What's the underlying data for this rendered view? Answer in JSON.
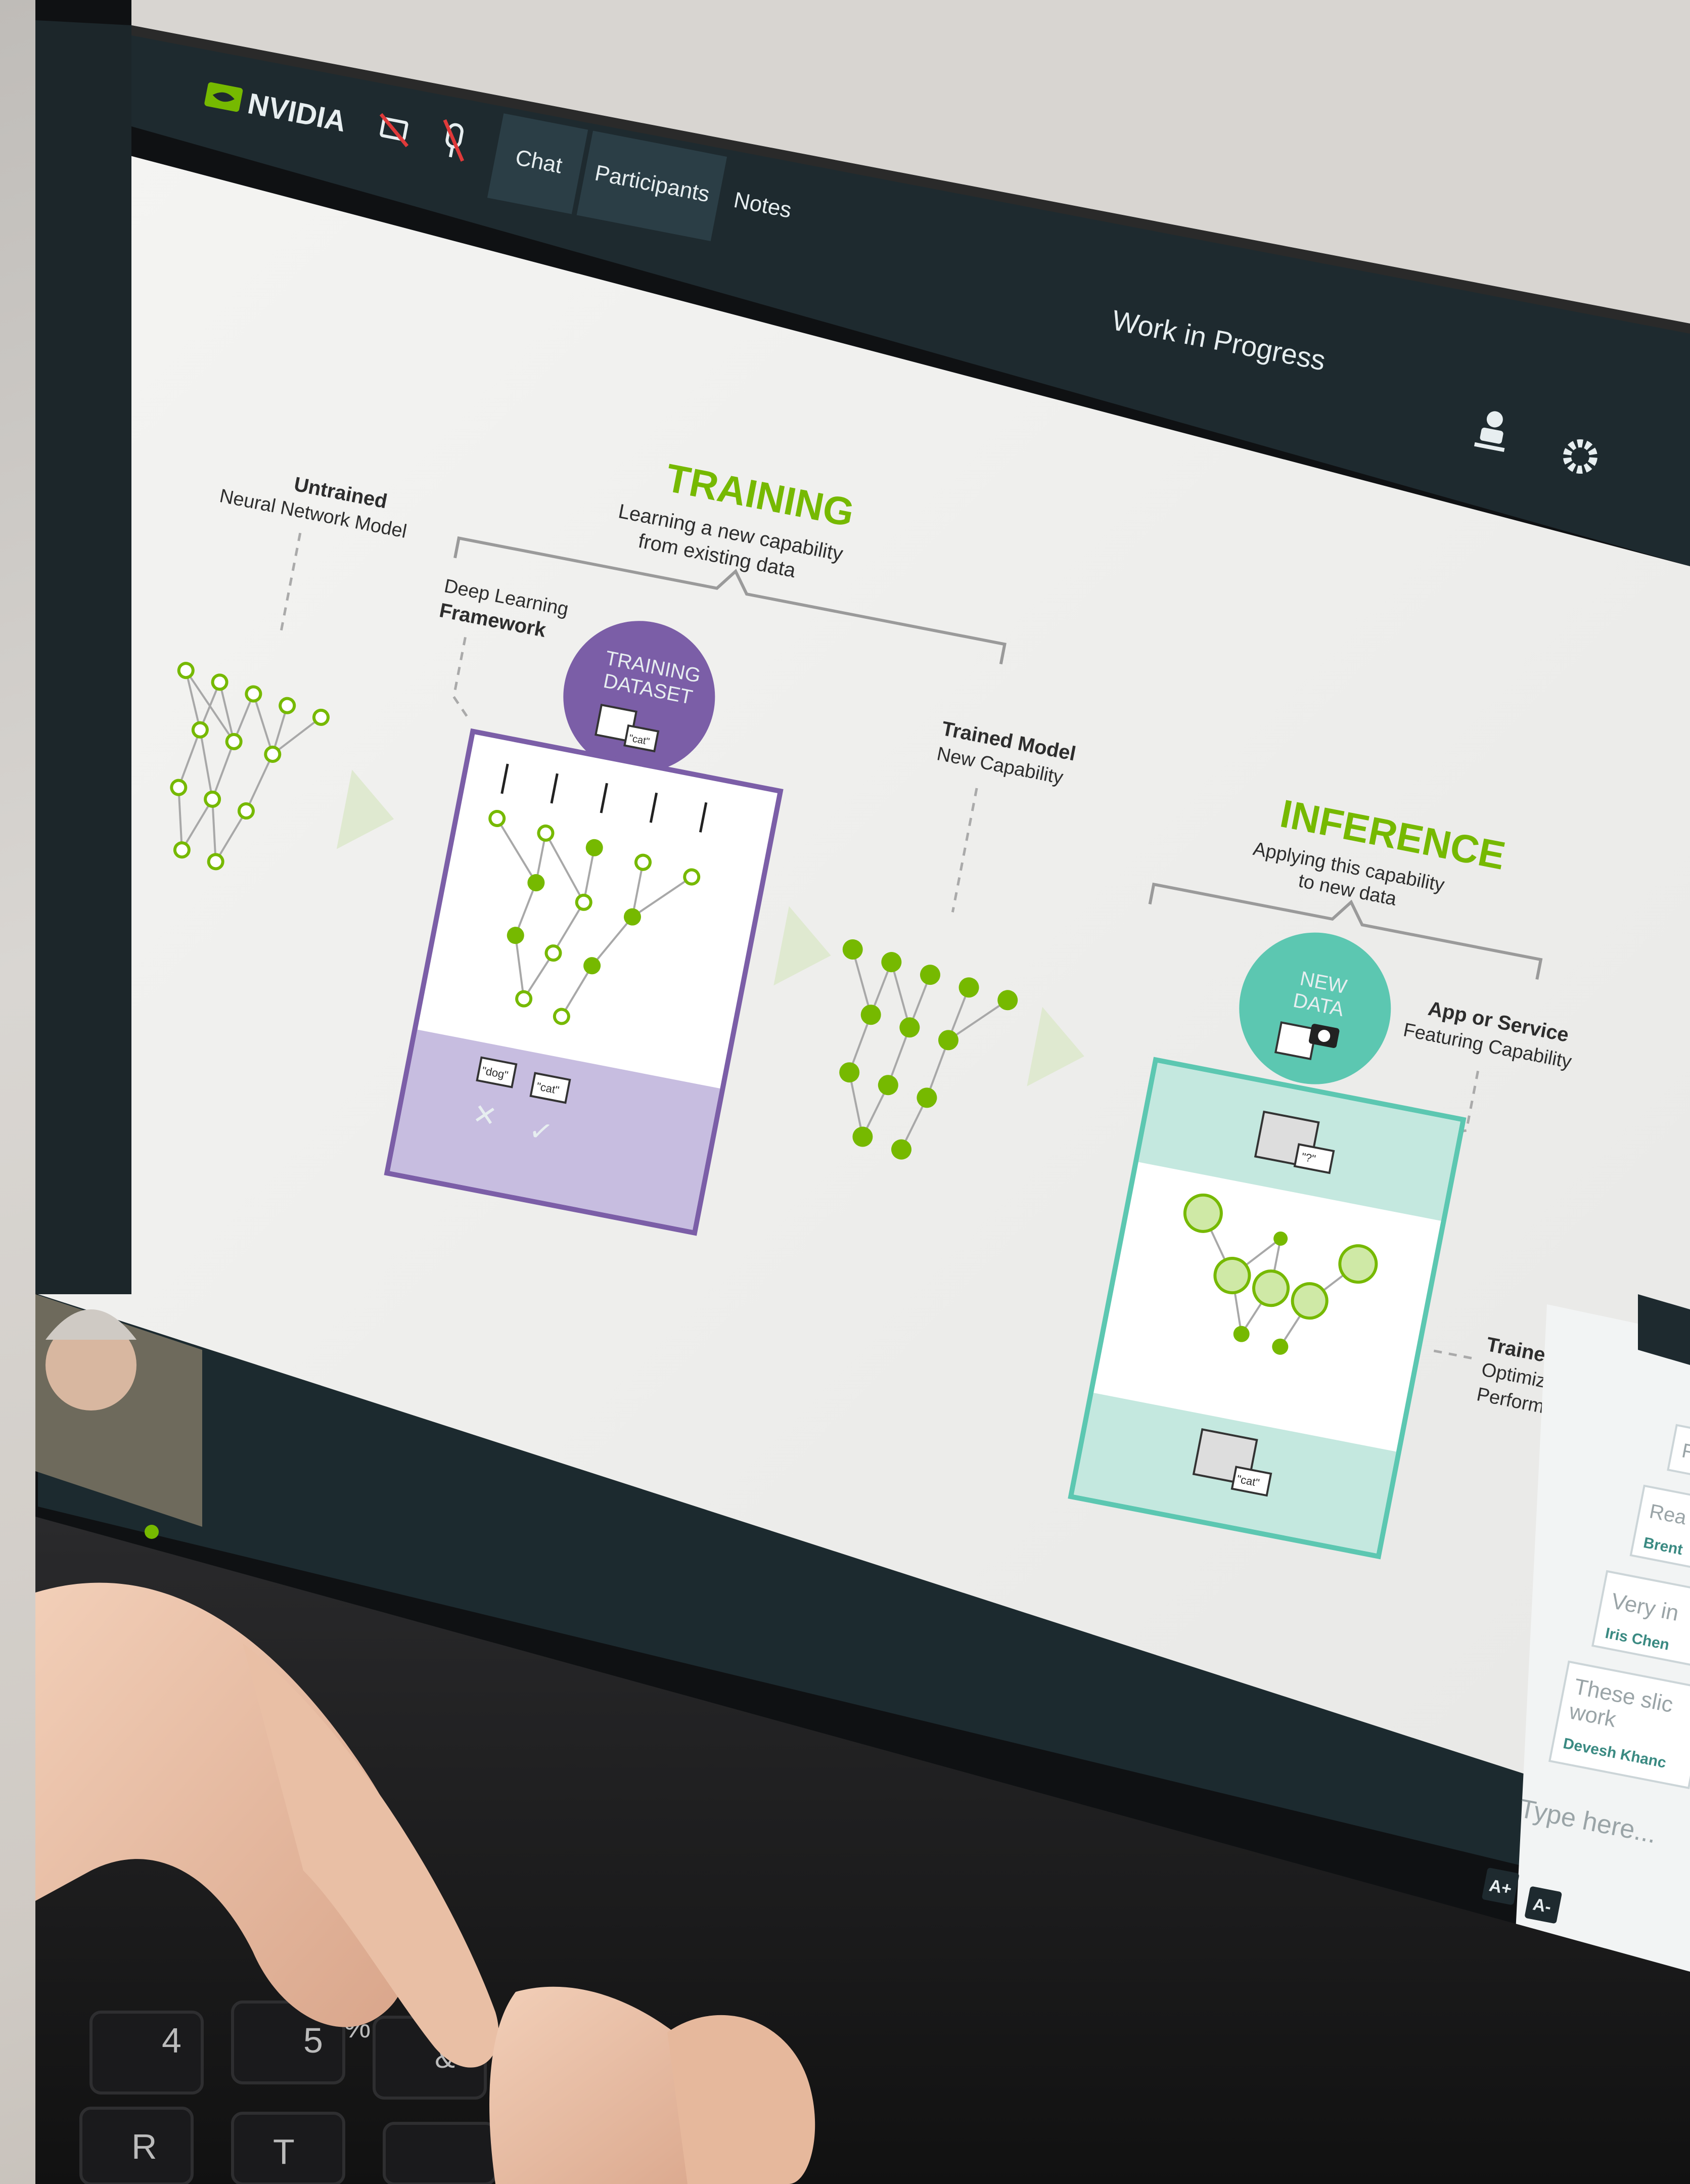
{
  "app": {
    "brand": "NVIDIA",
    "tabs": [
      "Chat",
      "Participants",
      "Notes"
    ],
    "session_title": "Work in Progress",
    "icons": [
      "camera-off-icon",
      "mic-off-icon",
      "presenter-icon",
      "gear-icon"
    ]
  },
  "slide": {
    "training": {
      "title": "TRAINING",
      "subtitle_1": "Learning a new capability",
      "subtitle_2": "from existing data",
      "untrained_1": "Untrained",
      "untrained_2": "Neural Network Model",
      "framework_1": "Deep Learning",
      "framework_2": "Framework",
      "dataset_1": "TRAINING",
      "dataset_2": "DATASET",
      "tag_cat": "\"cat\"",
      "tag_dog": "\"dog\"",
      "wrong": "✕",
      "right": "✓"
    },
    "trained": {
      "label_1": "Trained Model",
      "label_2": "New Capability"
    },
    "inference": {
      "title": "INFERENCE",
      "subtitle_1": "Applying this capability",
      "subtitle_2": "to new data",
      "new_data_1": "NEW",
      "new_data_2": "DATA",
      "app_1": "App or Service",
      "app_2": "Featuring Capability",
      "optimized_1": "Trained Model",
      "optimized_2": "Optimized for",
      "optimized_3": "Performance",
      "tag_q": "\"?\"",
      "tag_cat": "\"cat\""
    },
    "colors": {
      "green": "#76b900",
      "purple": "#7b5ea7",
      "teal": "#5cc7b1"
    }
  },
  "chat": {
    "messages": [
      {
        "text": "Fr",
        "author": ""
      },
      {
        "text": "Rea",
        "author": "Brent"
      },
      {
        "text": "Very in",
        "author": "Iris Chen"
      },
      {
        "text": "These slic",
        "text2": "work",
        "author": "Devesh Khanc"
      }
    ],
    "input_placeholder": "Type here...",
    "font_up": "A+",
    "font_down": "A-"
  },
  "keyboard": {
    "keys": [
      "4",
      "5",
      "R",
      "T",
      "%",
      "&"
    ]
  }
}
